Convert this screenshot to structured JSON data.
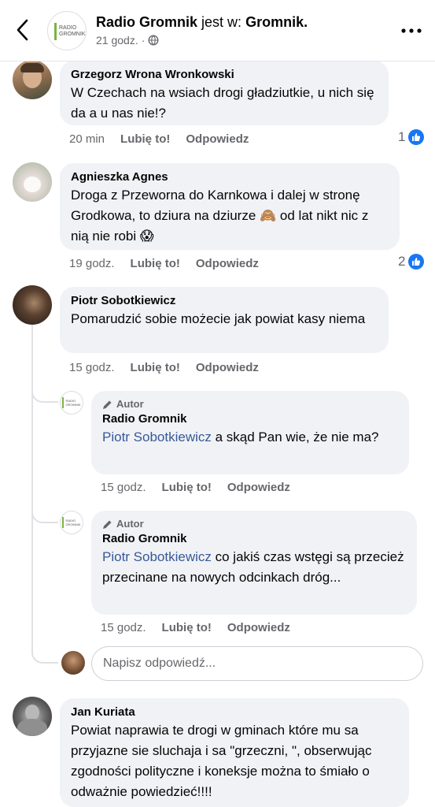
{
  "header": {
    "page_name": "Radio Gromnik",
    "is_in": "jest w:",
    "location": "Gromnik.",
    "time": "21 godz.",
    "privacy_sep": "·",
    "logo_line1": "RADIO",
    "logo_line2": "GROMNIK"
  },
  "labels": {
    "like": "Lubię to!",
    "reply": "Odpowiedz",
    "author_badge": "Autor",
    "reply_placeholder": "Napisz odpowiedź..."
  },
  "comments": [
    {
      "author": "Grzegorz Wrona Wronkowski",
      "text": "W Czechach na wsiach drogi gładziutkie, u nich się da a u nas nie!?",
      "time": "20 min",
      "reactions": "1"
    },
    {
      "author": "Agnieszka Agnes",
      "text_a": "Droga z Przeworna do Karnkowa i dalej w stronę Grodkowa, to dziura na dziurze ",
      "emoji_a": "🙈",
      "text_b": " od lat nikt nic z nią nie robi ",
      "emoji_b": "😱",
      "time": "19 godz.",
      "reactions": "2"
    },
    {
      "author": "Piotr Sobotkiewicz",
      "text": "Pomarudzić sobie możecie jak powiat kasy niema",
      "time": "15 godz."
    },
    {
      "author": "Jan Kuriata",
      "text": "Powiat naprawia te drogi w gminach które mu sa przyjazne sie sluchaja i sa \"grzeczni, \", obserwując zgodności polityczne i koneksje można to śmiało o odważnie powiedzieć!!!!"
    }
  ],
  "replies": [
    {
      "author": "Radio Gromnik",
      "mention": "Piotr Sobotkiewicz",
      "text": " a skąd Pan wie, że nie ma?",
      "time": "15 godz."
    },
    {
      "author": "Radio Gromnik",
      "mention": "Piotr Sobotkiewicz",
      "text": " co jakiś czas wstęgi są przecież przecinane na nowych odcinkach dróg...",
      "time": "15 godz."
    }
  ],
  "colors": {
    "accent": "#1877f2",
    "mention": "#385898",
    "bubble": "#f0f2f5",
    "secondary_text": "#65676b"
  }
}
